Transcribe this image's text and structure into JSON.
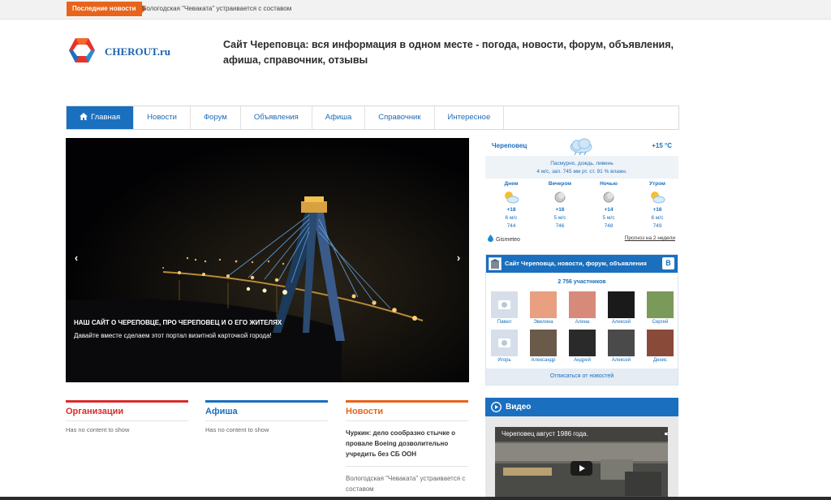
{
  "ticker": {
    "label": "Последние новости",
    "text": "Вологодская \"Чеваката\" устраивается с составом"
  },
  "header": {
    "logo_text": "CHEROUT.ru",
    "title": "Сайт Череповца: вся информация в одном месте - погода, новости, форум, объявления, афиша, справочник, отзывы"
  },
  "nav": {
    "items": [
      {
        "label": "Главная",
        "active": true
      },
      {
        "label": "Новости"
      },
      {
        "label": "Форум"
      },
      {
        "label": "Объявления"
      },
      {
        "label": "Афиша"
      },
      {
        "label": "Справочник"
      },
      {
        "label": "Интересное"
      }
    ]
  },
  "slider": {
    "prev": "‹",
    "next": "›",
    "title": "НАШ САЙТ О ЧЕРЕПОВЦЕ, ПРО ЧЕРЕПОВЕЦ И О ЕГО ЖИТЕЛЯХ",
    "subtitle": "Давайте вместе сделаем этот портал визитной карточкой города!"
  },
  "columns": {
    "org": {
      "title": "Организации",
      "empty": "Has no content to show"
    },
    "afisha": {
      "title": "Афиша",
      "empty": "Has no content to show"
    },
    "news": {
      "title": "Новости",
      "item1": "Чуркин: дело сообразно стычке о провале Boeing дозволительно учредить без СБ ООН",
      "item2": "Вологодская \"Чеваката\" устраивается с составом"
    }
  },
  "weather": {
    "city": "Череповец",
    "temp": "+15 °C",
    "desc_line1": "Пасмурно, дождь, ливень",
    "desc_line2": "4 м/с, зап.   745 мм рт. ст.   91 % влажн.",
    "periods": [
      {
        "name": "Днем",
        "temp": "+18",
        "wind": "6 м/с",
        "pressure": "744",
        "icon": "sun-cloud"
      },
      {
        "name": "Вечером",
        "temp": "+16",
        "wind": "5 м/с",
        "pressure": "746",
        "icon": "moon"
      },
      {
        "name": "Ночью",
        "temp": "+14",
        "wind": "5 м/с",
        "pressure": "748",
        "icon": "moon"
      },
      {
        "name": "Утром",
        "temp": "+16",
        "wind": "6 м/с",
        "pressure": "749",
        "icon": "sun-cloud"
      }
    ],
    "provider": "Gismeteo",
    "forecast_link": "Прогноз на 2 недели"
  },
  "vk": {
    "title": "Сайт Череповца, новости, форум, объявления",
    "logo": "B",
    "count": "2 756 участников",
    "members": [
      {
        "name": "Павел",
        "color": "#d6dfe9"
      },
      {
        "name": "Эвелина",
        "color": "#e8a080"
      },
      {
        "name": "Алина",
        "color": "#d88a7a"
      },
      {
        "name": "Алексей",
        "color": "#1a1a1a"
      },
      {
        "name": "Сергей",
        "color": "#7a9a5a"
      },
      {
        "name": "Игорь",
        "color": "#d6dfe9"
      },
      {
        "name": "Александр",
        "color": "#6a5a4a"
      },
      {
        "name": "Андрей",
        "color": "#2a2a2a"
      },
      {
        "name": "Алексей",
        "color": "#4a4a4a"
      },
      {
        "name": "Денис",
        "color": "#8a4a3a"
      }
    ],
    "subscribe": "Отписаться от новостей"
  },
  "video": {
    "section_title": "Видео",
    "player_title": "Череповец август 1986 года."
  },
  "colors": {
    "accent_blue": "#1a6fbf",
    "accent_orange": "#e8641b",
    "accent_red": "#d92b2b"
  }
}
